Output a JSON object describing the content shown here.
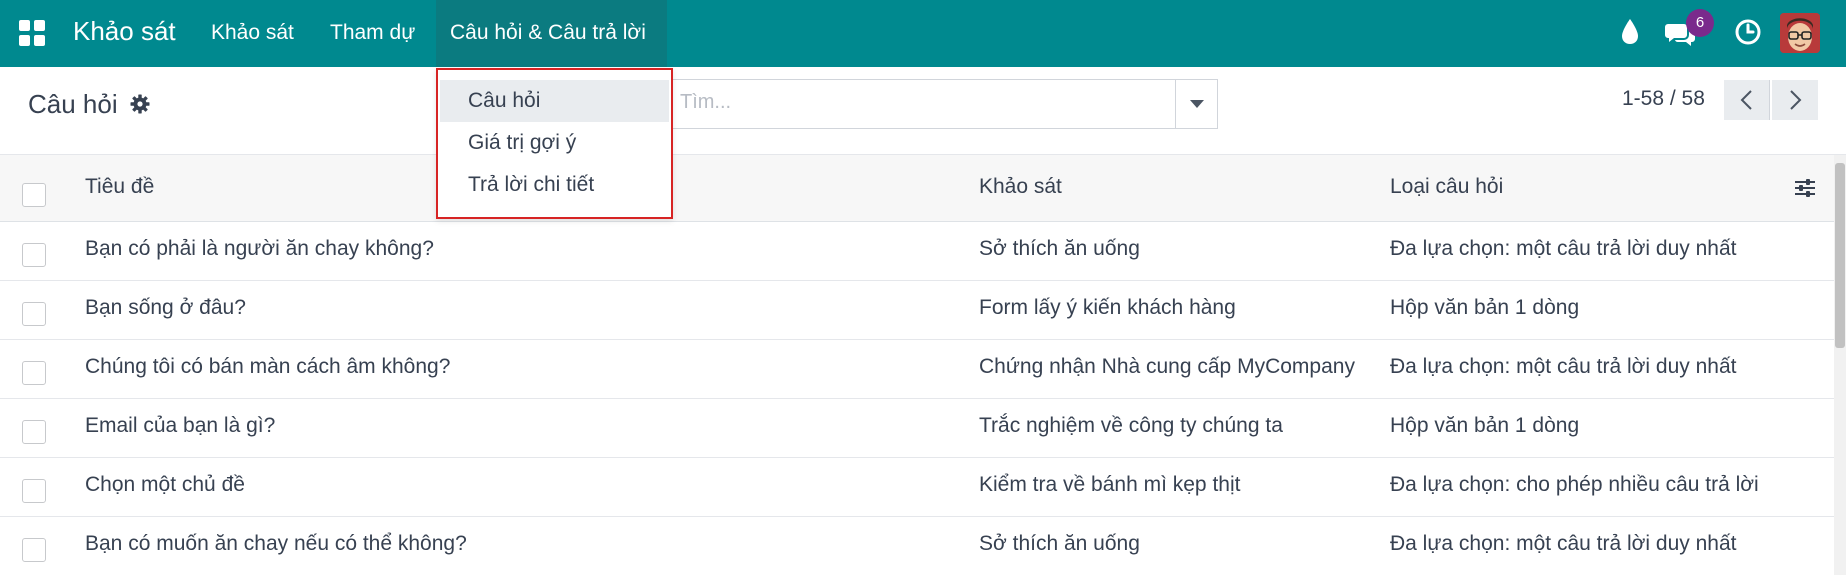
{
  "navbar": {
    "brand": "Khảo sát",
    "menu": [
      "Khảo sát",
      "Tham dự",
      "Câu hỏi & Câu trả lời"
    ],
    "badge_count": "6",
    "icons": [
      "apps-icon",
      "drop-icon",
      "chat-icon",
      "clock-icon",
      "avatar"
    ],
    "bg_color": "#00898f"
  },
  "control_panel": {
    "title": "Câu hỏi",
    "search_placeholder": "Tìm...",
    "pager": "1-58 / 58"
  },
  "dropdown": {
    "items": [
      "Câu hỏi",
      "Giá trị gợi ý",
      "Trả lời chi tiết"
    ],
    "active_index": 0
  },
  "table": {
    "columns": [
      "Tiêu đề",
      "Khảo sát",
      "Loại câu hỏi"
    ],
    "rows": [
      {
        "title": "Bạn có phải là người ăn chay không?",
        "survey": "Sở thích ăn uống",
        "type": "Đa lựa chọn: một câu trả lời duy nhất"
      },
      {
        "title": "Bạn sống ở đâu?",
        "survey": "Form lấy ý kiến khách hàng",
        "type": "Hộp văn bản 1 dòng"
      },
      {
        "title": "Chúng tôi có bán màn cách âm không?",
        "survey": "Chứng nhận Nhà cung cấp MyCompany",
        "type": "Đa lựa chọn: một câu trả lời duy nhất"
      },
      {
        "title": "Email của bạn là gì?",
        "survey": "Trắc nghiệm về công ty chúng ta",
        "type": "Hộp văn bản 1 dòng"
      },
      {
        "title": "Chọn một chủ đề",
        "survey": "Kiểm tra về bánh mì kẹp thịt",
        "type": "Đa lựa chọn: cho phép nhiều câu trả lời"
      },
      {
        "title": "Bạn có muốn ăn chay nếu có thể không?",
        "survey": "Sở thích ăn uống",
        "type": "Đa lựa chọn: một câu trả lời duy nhất"
      }
    ]
  }
}
